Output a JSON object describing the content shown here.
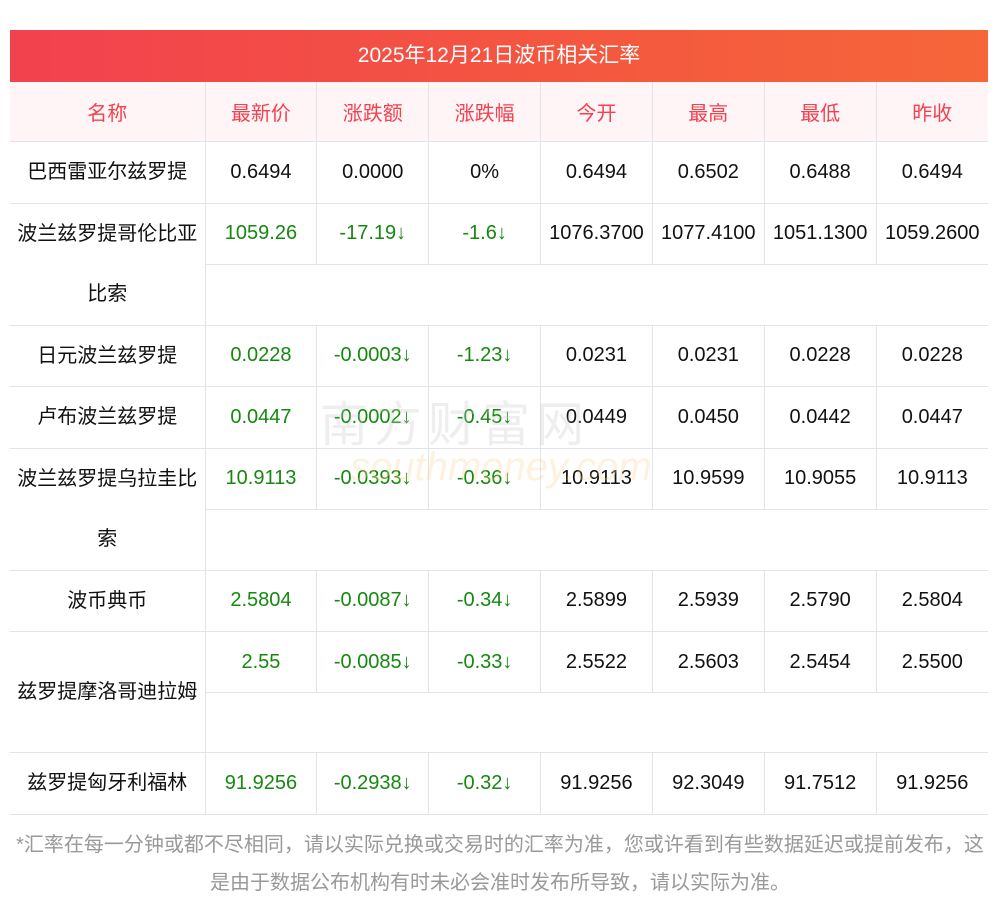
{
  "title": "2025年12月21日波币相关汇率",
  "headers": [
    "名称",
    "最新价",
    "涨跌额",
    "涨跌幅",
    "今开",
    "最高",
    "最低",
    "昨收"
  ],
  "rows": [
    {
      "name": "巴西雷亚尔兹罗提",
      "latest": "0.6494",
      "change": "0.0000",
      "pct": "0%",
      "open": "0.6494",
      "high": "0.6502",
      "low": "0.6488",
      "prev": "0.6494",
      "color": "black",
      "double": false
    },
    {
      "name": "波兰兹罗提哥伦比亚比索",
      "latest": "1059.26",
      "change": "-17.19↓",
      "pct": "-1.6↓",
      "open": "1076.3700",
      "high": "1077.4100",
      "low": "1051.1300",
      "prev": "1059.2600",
      "color": "green",
      "double": true
    },
    {
      "name": "日元波兰兹罗提",
      "latest": "0.0228",
      "change": "-0.0003↓",
      "pct": "-1.23↓",
      "open": "0.0231",
      "high": "0.0231",
      "low": "0.0228",
      "prev": "0.0228",
      "color": "green",
      "double": false
    },
    {
      "name": "卢布波兰兹罗提",
      "latest": "0.0447",
      "change": "-0.0002↓",
      "pct": "-0.45↓",
      "open": "0.0449",
      "high": "0.0450",
      "low": "0.0442",
      "prev": "0.0447",
      "color": "green",
      "double": false
    },
    {
      "name": "波兰兹罗提乌拉圭比索",
      "latest": "10.9113",
      "change": "-0.0393↓",
      "pct": "-0.36↓",
      "open": "10.9113",
      "high": "10.9599",
      "low": "10.9055",
      "prev": "10.9113",
      "color": "green",
      "double": true
    },
    {
      "name": "波币典币",
      "latest": "2.5804",
      "change": "-0.0087↓",
      "pct": "-0.34↓",
      "open": "2.5899",
      "high": "2.5939",
      "low": "2.5790",
      "prev": "2.5804",
      "color": "green",
      "double": false
    },
    {
      "name": "兹罗提摩洛哥迪拉姆",
      "latest": "2.55",
      "change": "-0.0085↓",
      "pct": "-0.33↓",
      "open": "2.5522",
      "high": "2.5603",
      "low": "2.5454",
      "prev": "2.5500",
      "color": "green",
      "double": true
    },
    {
      "name": "兹罗提匈牙利福林",
      "latest": "91.9256",
      "change": "-0.2938↓",
      "pct": "-0.32↓",
      "open": "91.9256",
      "high": "92.3049",
      "low": "91.7512",
      "prev": "91.9256",
      "color": "green",
      "double": false
    }
  ],
  "watermark": {
    "cn": "南方财富网",
    "en": "southmoney.com"
  },
  "note": "*汇率在每一分钟或都不尽相同，请以实际兑换或交易时的汇率为准，您或许看到有些数据延迟或提前发布，这是由于数据公布机构有时未必会准时发布所导致，请以实际为准。"
}
